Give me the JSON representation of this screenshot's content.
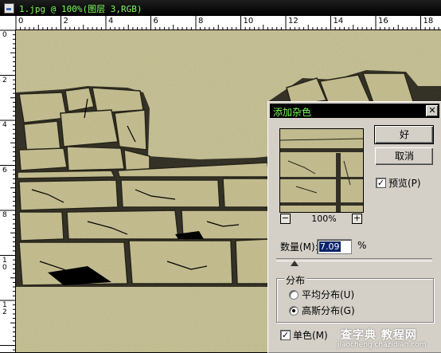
{
  "document": {
    "title": "1.jpg @ 100%(图层 3,RGB)",
    "ruler_top_numbers": [
      "0",
      "2",
      "4",
      "6",
      "8",
      "10",
      "12",
      "14",
      "16",
      "18"
    ],
    "ruler_left_numbers": [
      "0",
      "2",
      "4",
      "6",
      "8",
      "1\n0",
      "1\n2"
    ]
  },
  "dialog": {
    "title": "添加杂色",
    "close_label": "✕",
    "ok_label": "好",
    "cancel_label": "取消",
    "preview_label": "预览(P)",
    "preview_checked": "✓",
    "zoom_out": "−",
    "zoom_in": "+",
    "zoom_level": "100%",
    "amount_label": "数量(M):",
    "amount_value": "7.09",
    "amount_unit": "%",
    "distribution_label": "分布",
    "uniform_label": "平均分布(U)",
    "gaussian_label": "高斯分布(G)",
    "monochrome_label": "单色(M)",
    "monochrome_checked": "✓",
    "selected_distribution": "gaussian"
  },
  "watermark": {
    "line1": "查字典 教程网",
    "line2": "jiaocheng.chazidian.com"
  },
  "colors": {
    "title_bar": "#000000",
    "title_text": "#7cfc5a",
    "stone": "#d8d3a8",
    "mortar": "#111111",
    "selection": "#0a246a"
  }
}
